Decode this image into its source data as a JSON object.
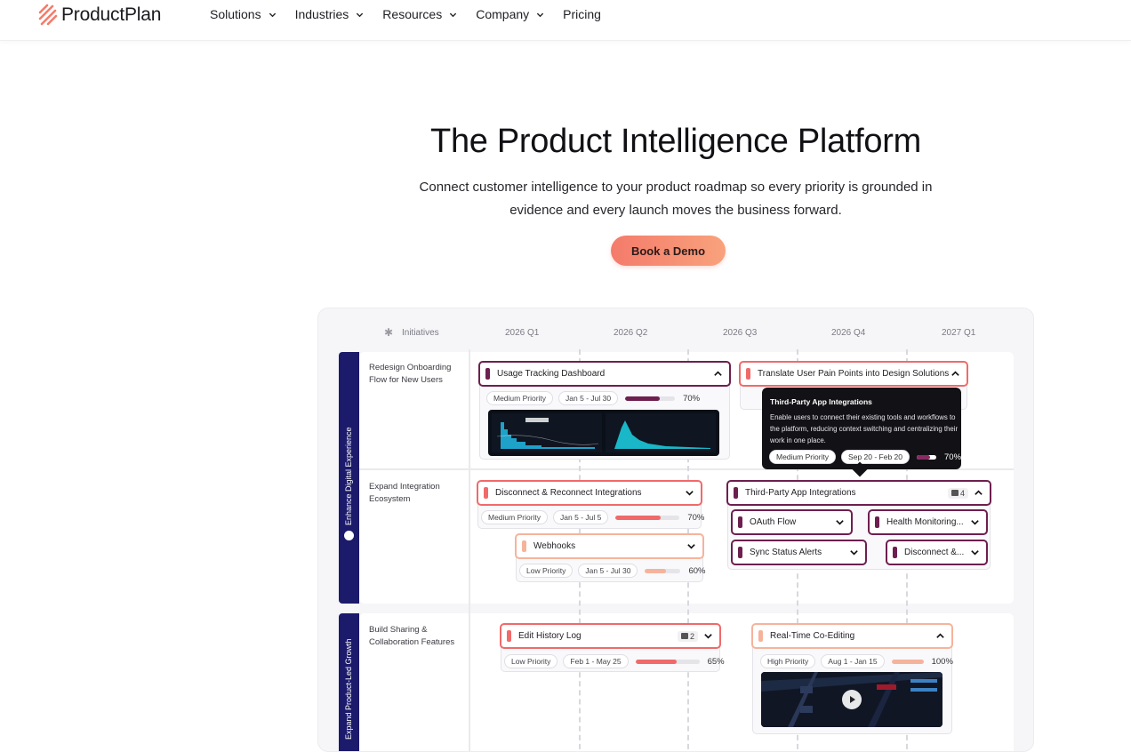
{
  "brand": {
    "name": "ProductPlan",
    "accent": "#f47b6b"
  },
  "nav": [
    {
      "label": "Solutions"
    },
    {
      "label": "Industries"
    },
    {
      "label": "Resources"
    },
    {
      "label": "Company"
    },
    {
      "label": "Pricing"
    }
  ],
  "hero": {
    "title": "The Product Intelligence Platform",
    "subtitle_line1": "Connect customer intelligence to your product roadmap so every priority is grounded in",
    "subtitle_line2": "evidence and every launch moves the business forward.",
    "cta": "Book a Demo"
  },
  "roadmap": {
    "initiatives_label": "Initiatives",
    "columns": [
      "2026 Q1",
      "2026 Q2",
      "2026 Q3",
      "2026 Q4",
      "2027 Q1"
    ],
    "groups": [
      "Enhance Digital Experience",
      "Expand Product-Led Growth"
    ],
    "rows": [
      "Redesign Onboarding Flow for New Users",
      "Expand Integration Ecosystem",
      "Build Sharing & Collaboration Features"
    ],
    "cards": {
      "usage": {
        "title": "Usage Tracking Dashboard",
        "priority": "Medium Priority",
        "dates": "Jan 5 - Jul 30",
        "progress": 70,
        "pct": "70%"
      },
      "translate": {
        "title": "Translate User Pain Points into Design Solutions"
      },
      "disconnect": {
        "title": "Disconnect & Reconnect Integrations",
        "priority": "Medium Priority",
        "dates": "Jan 5 - Jul 5",
        "progress": 70,
        "pct": "70%"
      },
      "webhooks": {
        "title": "Webhooks",
        "priority": "Low Priority",
        "dates": "Jan 5 - Jul 30",
        "progress": 60,
        "pct": "60%"
      },
      "thirdparty": {
        "title": "Third-Party App Integrations",
        "count": "4"
      },
      "oauth": {
        "title": "OAuth Flow"
      },
      "health": {
        "title": "Health Monitoring..."
      },
      "sync": {
        "title": "Sync Status Alerts"
      },
      "disconnect2": {
        "title": "Disconnect &..."
      },
      "edithistory": {
        "title": "Edit History Log",
        "count": "2",
        "priority": "Low Priority",
        "dates": "Feb 1 - May 25",
        "progress": 65,
        "pct": "65%"
      },
      "realtime": {
        "title": "Real-Time Co-Editing",
        "priority": "High Priority",
        "dates": "Aug 1 - Jan 15",
        "progress": 100,
        "pct": "100%"
      }
    },
    "tooltip": {
      "title": "Third-Party App Integrations",
      "body": "Enable users to connect their existing tools and workflows to the platform, reducing context switching and centralizing their work in one place.",
      "priority": "Medium Priority",
      "dates": "Sep 20 - Feb 20",
      "progress": 70,
      "pct": "70%"
    }
  }
}
